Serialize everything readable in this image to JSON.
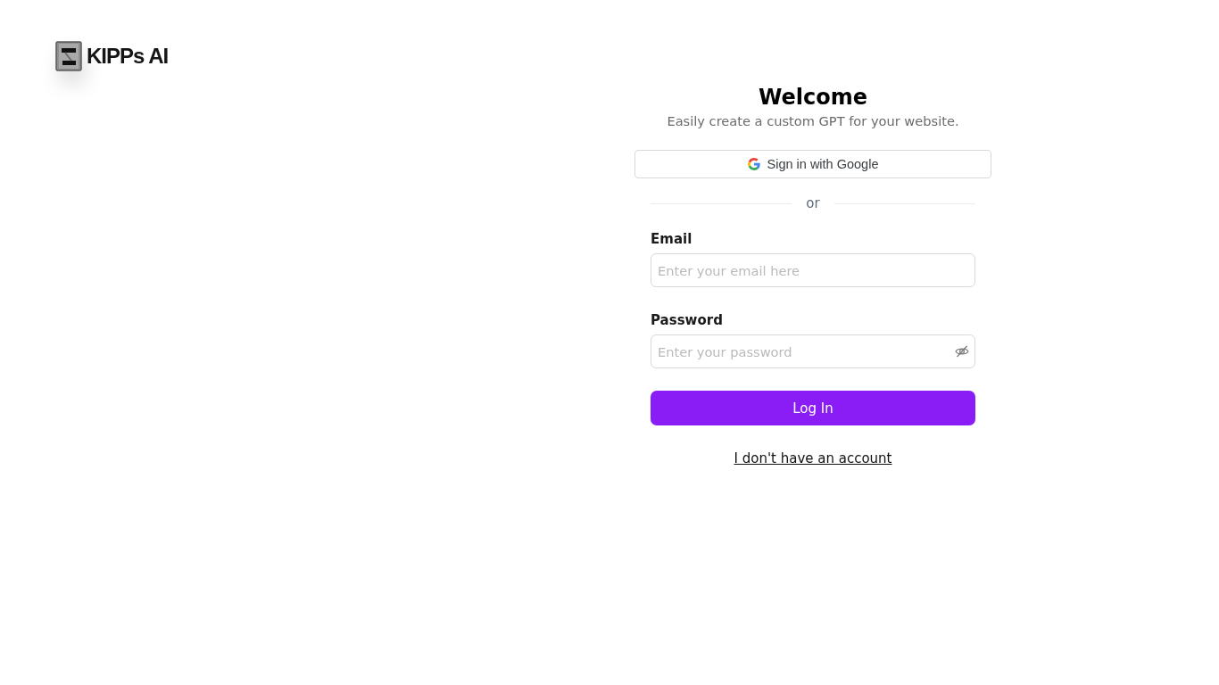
{
  "brand": {
    "name": "KIPPs AI"
  },
  "heading": "Welcome",
  "subtitle": "Easily create a custom GPT for your website.",
  "google_button": {
    "label": "Sign in with Google"
  },
  "divider": {
    "label": "or"
  },
  "email_field": {
    "label": "Email",
    "placeholder": "Enter your email here"
  },
  "password_field": {
    "label": "Password",
    "placeholder": "Enter your password",
    "visible": false
  },
  "submit_button": {
    "label": "Log In"
  },
  "signup_link": {
    "label": "I don't have an account"
  }
}
